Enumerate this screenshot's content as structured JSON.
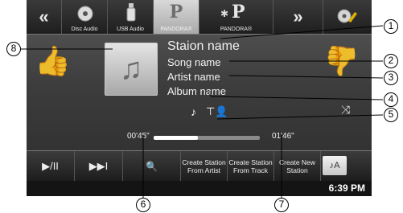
{
  "topbar": {
    "prev_glyph": "«",
    "next_glyph": "»",
    "sources": [
      {
        "label": "Disc Audio",
        "icon": "disc-icon"
      },
      {
        "label": "USB Audio",
        "icon": "usb-icon"
      },
      {
        "label": "PANDORA®",
        "glyph": "P",
        "icon": "pandora-icon",
        "active": true
      },
      {
        "label": "PANDORA®",
        "glyph": "P",
        "icon": "bluetooth-pandora-icon"
      }
    ],
    "setup_icon": "setup-disc-wrench-icon"
  },
  "now_playing": {
    "station": "Staion name",
    "song": "Song name",
    "artist": "Artist name",
    "album": "Album name",
    "art_glyph": "♫",
    "thumbs_up_glyph": "👍",
    "thumbs_down_glyph": "👎"
  },
  "status": {
    "note_glyph": "♪",
    "person_glyph": "⊤👤",
    "shuffle_glyph": "⤨"
  },
  "progress": {
    "elapsed": "00'45\"",
    "total": "01'46\"",
    "fraction": 0.42
  },
  "controls": {
    "play_pause": "▶/II",
    "skip": "▶▶I",
    "search_glyph": "🔍",
    "station_from_artist": [
      "Create Station",
      "From Artist"
    ],
    "station_from_track": [
      "Create Station",
      "From Track"
    ],
    "new_station": [
      "Create New",
      "Station"
    ],
    "media_glyph": "♪A"
  },
  "clock": "6:39 PM",
  "callouts": [
    "1",
    "2",
    "3",
    "4",
    "5",
    "6",
    "7",
    "8"
  ]
}
